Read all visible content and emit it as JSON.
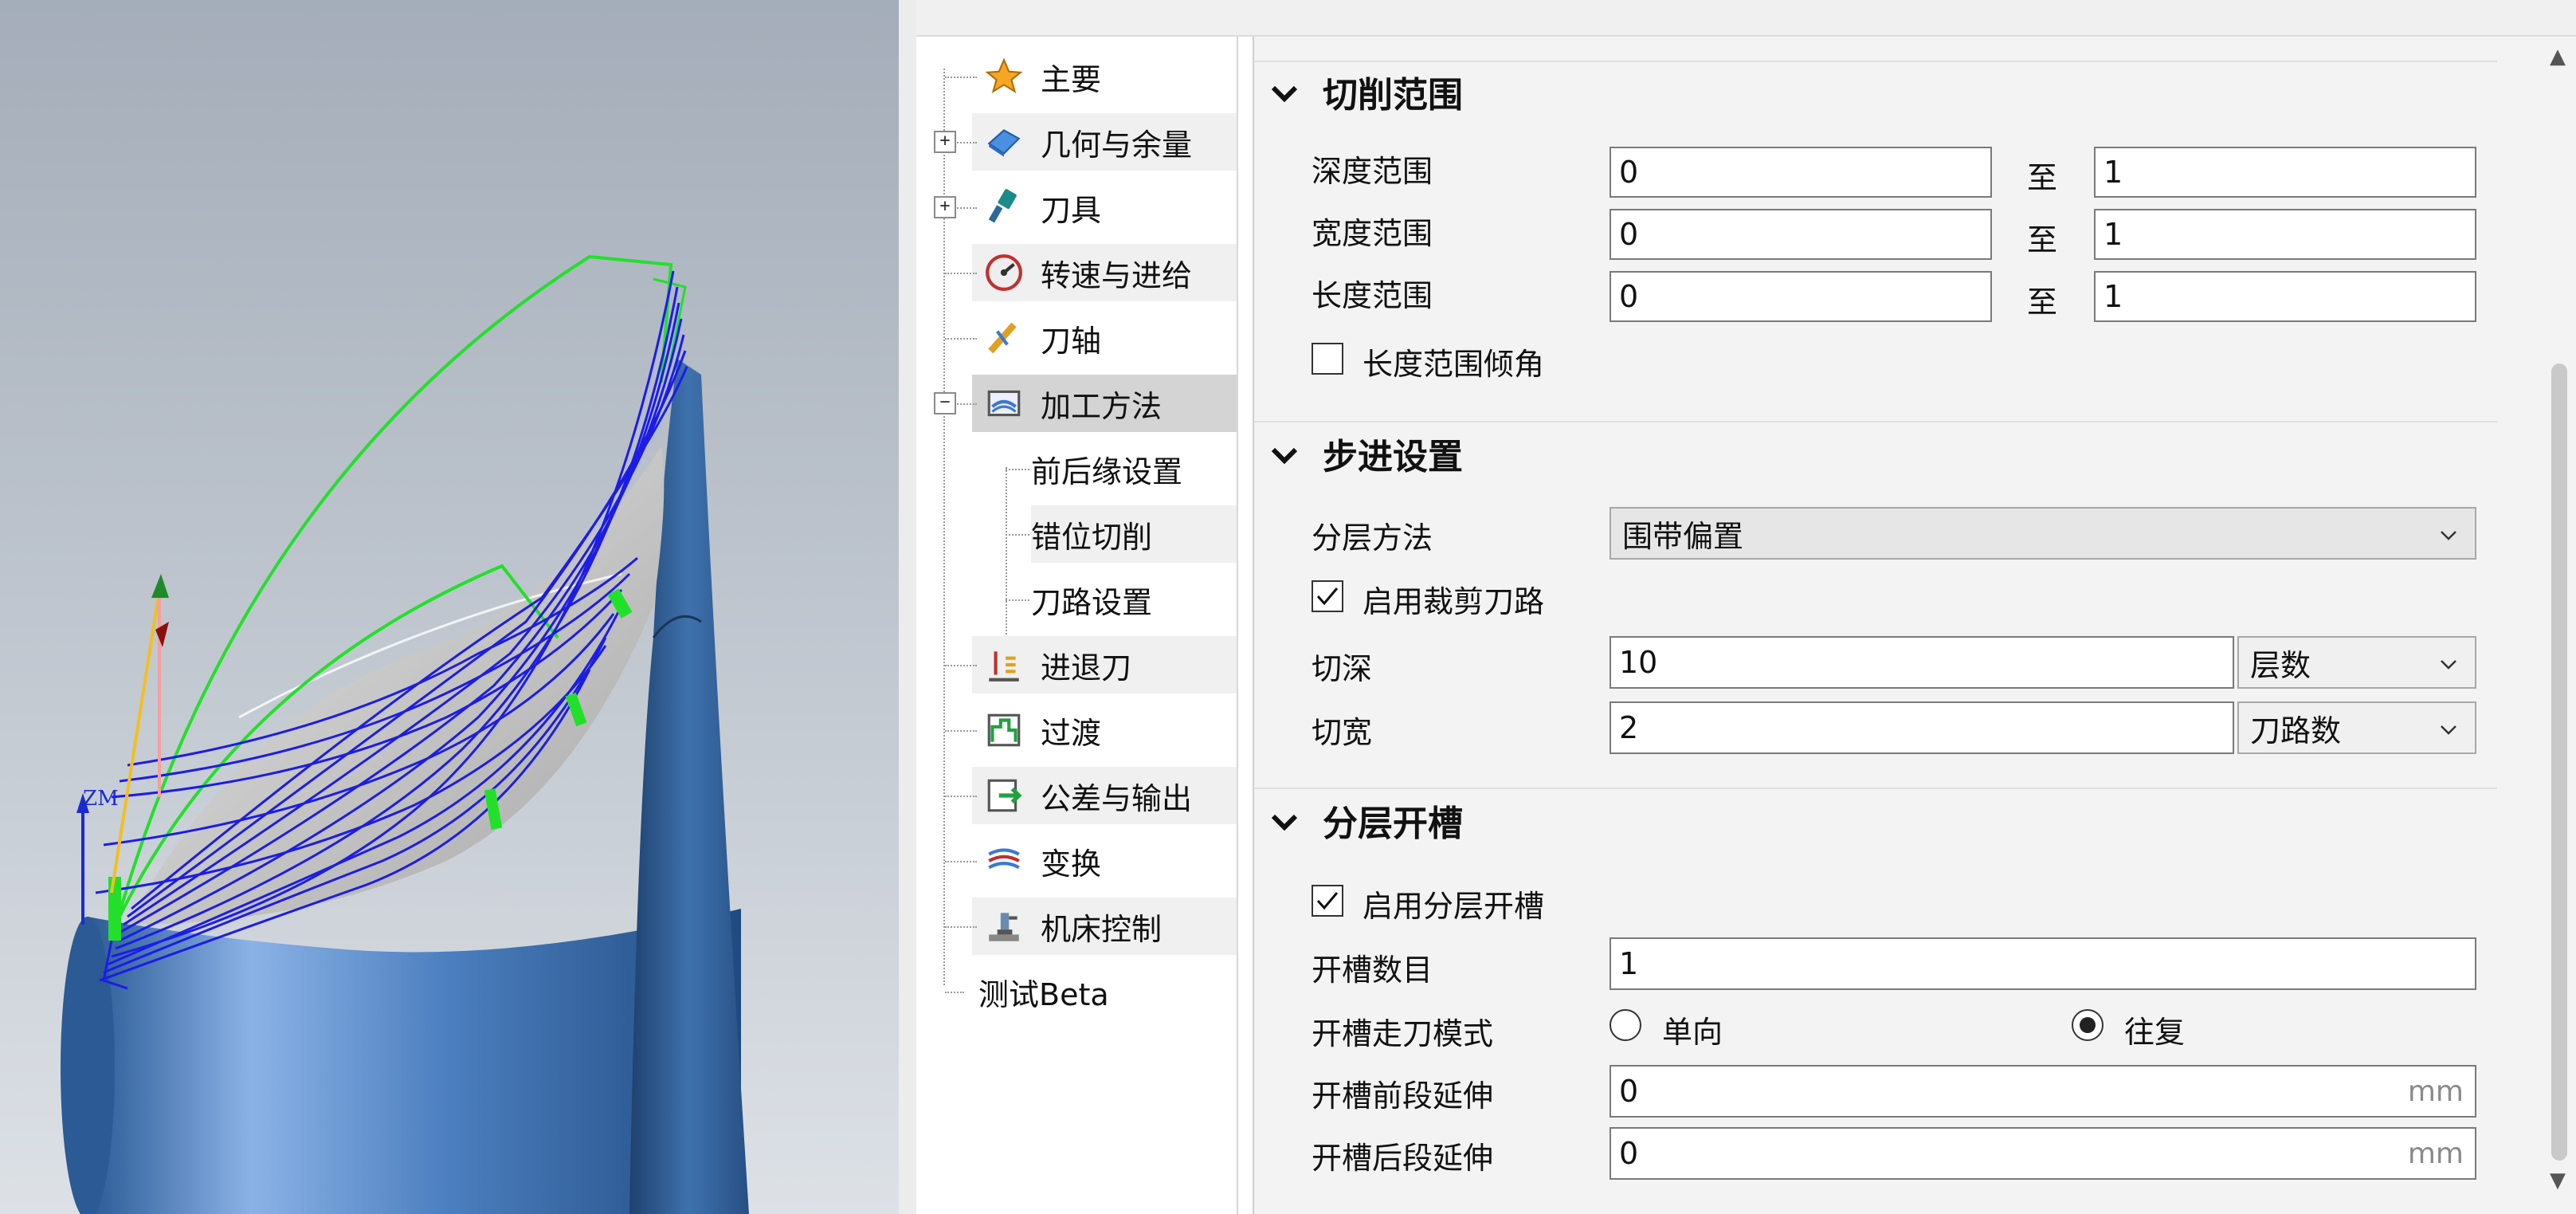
{
  "tree": {
    "items": [
      {
        "label": "主要"
      },
      {
        "label": "几何与余量"
      },
      {
        "label": "刀具"
      },
      {
        "label": "转速与进给"
      },
      {
        "label": "刀轴"
      },
      {
        "label": "加工方法"
      },
      {
        "label": "进退刀"
      },
      {
        "label": "过渡"
      },
      {
        "label": "公差与输出"
      },
      {
        "label": "变换"
      },
      {
        "label": "机床控制"
      },
      {
        "label": "测试Beta"
      }
    ],
    "sub_items": [
      {
        "label": "前后缘设置"
      },
      {
        "label": "错位切削"
      },
      {
        "label": "刀路设置"
      }
    ]
  },
  "viewport": {
    "axis_label": "ZM"
  },
  "sections": {
    "cut_range": {
      "title": "切削范围",
      "to_label": "至",
      "depth": {
        "label": "深度范围",
        "from": "0",
        "to": "1"
      },
      "width": {
        "label": "宽度范围",
        "from": "0",
        "to": "1"
      },
      "length": {
        "label": "长度范围",
        "from": "0",
        "to": "1"
      },
      "tilt": {
        "label": "长度范围倾角",
        "checked": false
      }
    },
    "step": {
      "title": "步进设置",
      "layer_method": {
        "label": "分层方法",
        "value": "围带偏置"
      },
      "trim": {
        "label": "启用裁剪刀路",
        "checked": true
      },
      "cut_depth": {
        "label": "切深",
        "value": "10",
        "mode": "层数"
      },
      "cut_width": {
        "label": "切宽",
        "value": "2",
        "mode": "刀路数"
      }
    },
    "slot": {
      "title": "分层开槽",
      "enable": {
        "label": "启用分层开槽",
        "checked": true
      },
      "count": {
        "label": "开槽数目",
        "value": "1"
      },
      "mode": {
        "label": "开槽走刀模式",
        "option1": "单向",
        "option2": "往复",
        "selected": "往复"
      },
      "front_ext": {
        "label": "开槽前段延伸",
        "value": "0",
        "unit": "mm"
      },
      "back_ext": {
        "label": "开槽后段延伸",
        "value": "0",
        "unit": "mm"
      }
    }
  }
}
